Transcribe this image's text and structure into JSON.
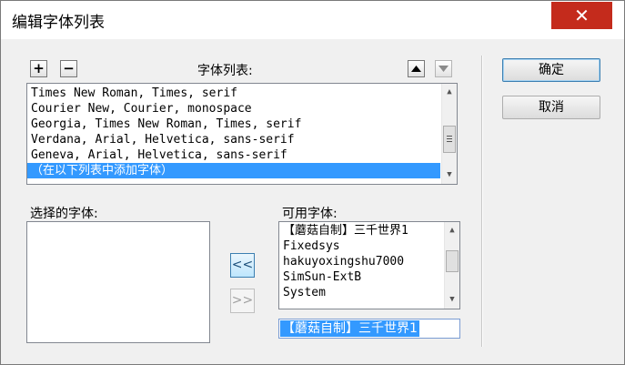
{
  "window": {
    "title": "编辑字体列表",
    "close_glyph": "✕"
  },
  "toolbar": {
    "add_label": "+",
    "remove_label": "−",
    "move_up_icon": "triangle-up-icon",
    "move_down_icon": "triangle-down-icon"
  },
  "font_list": {
    "label": "字体列表:",
    "items": [
      "Times New Roman, Times, serif",
      "Courier New, Courier, monospace",
      "Georgia, Times New Roman, Times, serif",
      "Verdana, Arial, Helvetica, sans-serif",
      "Geneva, Arial, Helvetica, sans-serif",
      "（在以下列表中添加字体）"
    ],
    "selected_index": 5
  },
  "chosen_fonts": {
    "label": "选择的字体:",
    "items": []
  },
  "available_fonts": {
    "label": "可用字体:",
    "items": [
      "【蘑菇自制】三千世界1",
      "Fixedsys",
      "hakuyoxingshu7000",
      "SimSun-ExtB",
      "System"
    ],
    "input_value": "【蘑菇自制】三千世界1"
  },
  "transfer": {
    "add_label": "<<",
    "remove_label": ">>"
  },
  "buttons": {
    "ok": "确定",
    "cancel": "取消"
  },
  "colors": {
    "selection": "#3399ff",
    "close_button": "#c42b1c",
    "dialog_bg": "#f0f0f0"
  }
}
